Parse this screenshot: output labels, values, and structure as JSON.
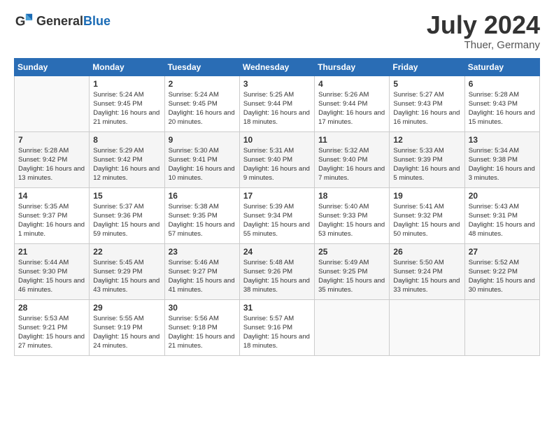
{
  "header": {
    "logo_general": "General",
    "logo_blue": "Blue",
    "month_year": "July 2024",
    "location": "Thuer, Germany"
  },
  "weekdays": [
    "Sunday",
    "Monday",
    "Tuesday",
    "Wednesday",
    "Thursday",
    "Friday",
    "Saturday"
  ],
  "weeks": [
    [
      {
        "day": "",
        "sunrise": "",
        "sunset": "",
        "daylight": ""
      },
      {
        "day": "1",
        "sunrise": "Sunrise: 5:24 AM",
        "sunset": "Sunset: 9:45 PM",
        "daylight": "Daylight: 16 hours and 21 minutes."
      },
      {
        "day": "2",
        "sunrise": "Sunrise: 5:24 AM",
        "sunset": "Sunset: 9:45 PM",
        "daylight": "Daylight: 16 hours and 20 minutes."
      },
      {
        "day": "3",
        "sunrise": "Sunrise: 5:25 AM",
        "sunset": "Sunset: 9:44 PM",
        "daylight": "Daylight: 16 hours and 18 minutes."
      },
      {
        "day": "4",
        "sunrise": "Sunrise: 5:26 AM",
        "sunset": "Sunset: 9:44 PM",
        "daylight": "Daylight: 16 hours and 17 minutes."
      },
      {
        "day": "5",
        "sunrise": "Sunrise: 5:27 AM",
        "sunset": "Sunset: 9:43 PM",
        "daylight": "Daylight: 16 hours and 16 minutes."
      },
      {
        "day": "6",
        "sunrise": "Sunrise: 5:28 AM",
        "sunset": "Sunset: 9:43 PM",
        "daylight": "Daylight: 16 hours and 15 minutes."
      }
    ],
    [
      {
        "day": "7",
        "sunrise": "Sunrise: 5:28 AM",
        "sunset": "Sunset: 9:42 PM",
        "daylight": "Daylight: 16 hours and 13 minutes."
      },
      {
        "day": "8",
        "sunrise": "Sunrise: 5:29 AM",
        "sunset": "Sunset: 9:42 PM",
        "daylight": "Daylight: 16 hours and 12 minutes."
      },
      {
        "day": "9",
        "sunrise": "Sunrise: 5:30 AM",
        "sunset": "Sunset: 9:41 PM",
        "daylight": "Daylight: 16 hours and 10 minutes."
      },
      {
        "day": "10",
        "sunrise": "Sunrise: 5:31 AM",
        "sunset": "Sunset: 9:40 PM",
        "daylight": "Daylight: 16 hours and 9 minutes."
      },
      {
        "day": "11",
        "sunrise": "Sunrise: 5:32 AM",
        "sunset": "Sunset: 9:40 PM",
        "daylight": "Daylight: 16 hours and 7 minutes."
      },
      {
        "day": "12",
        "sunrise": "Sunrise: 5:33 AM",
        "sunset": "Sunset: 9:39 PM",
        "daylight": "Daylight: 16 hours and 5 minutes."
      },
      {
        "day": "13",
        "sunrise": "Sunrise: 5:34 AM",
        "sunset": "Sunset: 9:38 PM",
        "daylight": "Daylight: 16 hours and 3 minutes."
      }
    ],
    [
      {
        "day": "14",
        "sunrise": "Sunrise: 5:35 AM",
        "sunset": "Sunset: 9:37 PM",
        "daylight": "Daylight: 16 hours and 1 minute."
      },
      {
        "day": "15",
        "sunrise": "Sunrise: 5:37 AM",
        "sunset": "Sunset: 9:36 PM",
        "daylight": "Daylight: 15 hours and 59 minutes."
      },
      {
        "day": "16",
        "sunrise": "Sunrise: 5:38 AM",
        "sunset": "Sunset: 9:35 PM",
        "daylight": "Daylight: 15 hours and 57 minutes."
      },
      {
        "day": "17",
        "sunrise": "Sunrise: 5:39 AM",
        "sunset": "Sunset: 9:34 PM",
        "daylight": "Daylight: 15 hours and 55 minutes."
      },
      {
        "day": "18",
        "sunrise": "Sunrise: 5:40 AM",
        "sunset": "Sunset: 9:33 PM",
        "daylight": "Daylight: 15 hours and 53 minutes."
      },
      {
        "day": "19",
        "sunrise": "Sunrise: 5:41 AM",
        "sunset": "Sunset: 9:32 PM",
        "daylight": "Daylight: 15 hours and 50 minutes."
      },
      {
        "day": "20",
        "sunrise": "Sunrise: 5:43 AM",
        "sunset": "Sunset: 9:31 PM",
        "daylight": "Daylight: 15 hours and 48 minutes."
      }
    ],
    [
      {
        "day": "21",
        "sunrise": "Sunrise: 5:44 AM",
        "sunset": "Sunset: 9:30 PM",
        "daylight": "Daylight: 15 hours and 46 minutes."
      },
      {
        "day": "22",
        "sunrise": "Sunrise: 5:45 AM",
        "sunset": "Sunset: 9:29 PM",
        "daylight": "Daylight: 15 hours and 43 minutes."
      },
      {
        "day": "23",
        "sunrise": "Sunrise: 5:46 AM",
        "sunset": "Sunset: 9:27 PM",
        "daylight": "Daylight: 15 hours and 41 minutes."
      },
      {
        "day": "24",
        "sunrise": "Sunrise: 5:48 AM",
        "sunset": "Sunset: 9:26 PM",
        "daylight": "Daylight: 15 hours and 38 minutes."
      },
      {
        "day": "25",
        "sunrise": "Sunrise: 5:49 AM",
        "sunset": "Sunset: 9:25 PM",
        "daylight": "Daylight: 15 hours and 35 minutes."
      },
      {
        "day": "26",
        "sunrise": "Sunrise: 5:50 AM",
        "sunset": "Sunset: 9:24 PM",
        "daylight": "Daylight: 15 hours and 33 minutes."
      },
      {
        "day": "27",
        "sunrise": "Sunrise: 5:52 AM",
        "sunset": "Sunset: 9:22 PM",
        "daylight": "Daylight: 15 hours and 30 minutes."
      }
    ],
    [
      {
        "day": "28",
        "sunrise": "Sunrise: 5:53 AM",
        "sunset": "Sunset: 9:21 PM",
        "daylight": "Daylight: 15 hours and 27 minutes."
      },
      {
        "day": "29",
        "sunrise": "Sunrise: 5:55 AM",
        "sunset": "Sunset: 9:19 PM",
        "daylight": "Daylight: 15 hours and 24 minutes."
      },
      {
        "day": "30",
        "sunrise": "Sunrise: 5:56 AM",
        "sunset": "Sunset: 9:18 PM",
        "daylight": "Daylight: 15 hours and 21 minutes."
      },
      {
        "day": "31",
        "sunrise": "Sunrise: 5:57 AM",
        "sunset": "Sunset: 9:16 PM",
        "daylight": "Daylight: 15 hours and 18 minutes."
      },
      {
        "day": "",
        "sunrise": "",
        "sunset": "",
        "daylight": ""
      },
      {
        "day": "",
        "sunrise": "",
        "sunset": "",
        "daylight": ""
      },
      {
        "day": "",
        "sunrise": "",
        "sunset": "",
        "daylight": ""
      }
    ]
  ]
}
